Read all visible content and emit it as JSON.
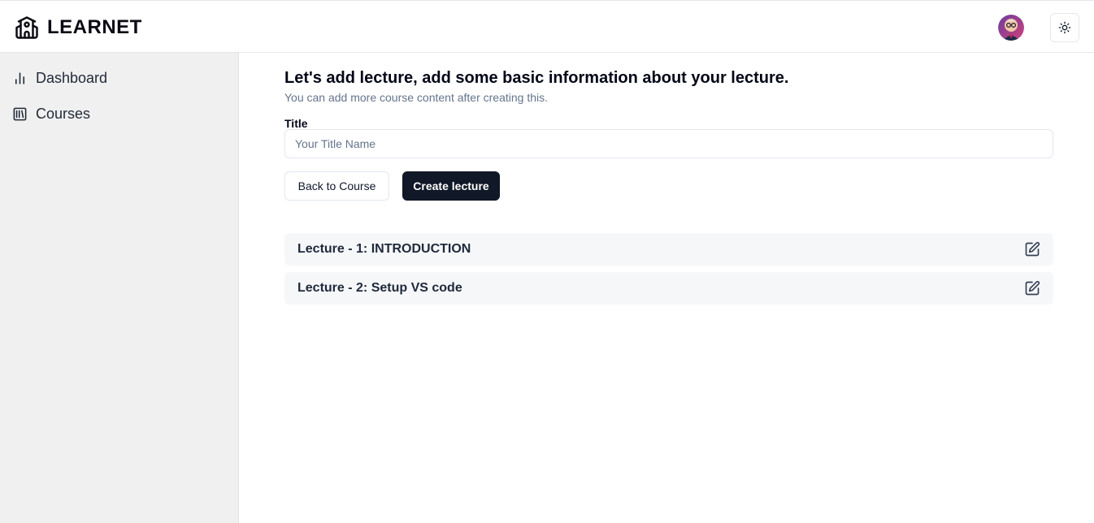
{
  "app": {
    "logo_text": "LEARNET",
    "icons": {
      "logo": "school-icon",
      "theme_toggle": "sun-icon",
      "edit": "edit-icon"
    }
  },
  "sidebar": {
    "items": [
      {
        "label": "Dashboard",
        "icon": "bar-chart-icon"
      },
      {
        "label": "Courses",
        "icon": "library-icon"
      }
    ]
  },
  "main": {
    "heading": "Let's add lecture, add some basic information about your lecture.",
    "subtext": "You can add more course content after creating this.",
    "title_field": {
      "label": "Title",
      "placeholder": "Your Title Name",
      "value": ""
    },
    "back_button": "Back to Course",
    "create_button": "Create lecture",
    "lectures": [
      {
        "title": "Lecture - 1: INTRODUCTION"
      },
      {
        "title": "Lecture - 2: Setup VS code"
      }
    ]
  },
  "colors": {
    "primary_button": "#111827",
    "sidebar_bg": "#f0f0f0",
    "lecture_row_bg": "#f6f7f9"
  }
}
